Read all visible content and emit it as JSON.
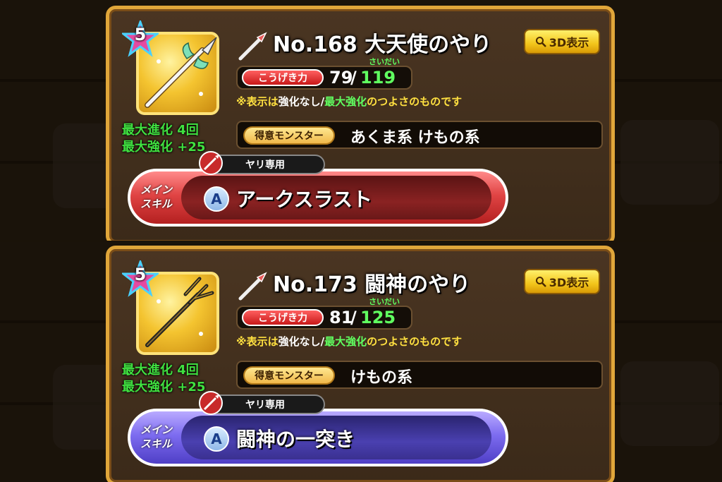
{
  "weapons": [
    {
      "rarity": "5",
      "number_name": "No.168  大天使のやり",
      "view3d_label": "3D表示",
      "attack_label": "こうげき力",
      "attack_current": "79",
      "attack_separator": "/",
      "attack_max": "119",
      "attack_furigana": "さいだい",
      "note_prefix": "※表示は",
      "note_plain": "強化なし/",
      "note_max": "最大強化",
      "note_suffix": "のつよさのものです",
      "max_evolution": "最大進化 4回",
      "max_enhance": "最大強化 +25",
      "monster_label": "得意モンスター",
      "monster_value": "あくま系 けもの系",
      "exclusive_label": "ヤリ専用",
      "main_skill_label_1": "メイン",
      "main_skill_label_2": "スキル",
      "skill_grade": "A",
      "skill_name": "アークスラスト",
      "skill_color": "#c82a2a"
    },
    {
      "rarity": "5",
      "number_name": "No.173  闘神のやり",
      "view3d_label": "3D表示",
      "attack_label": "こうげき力",
      "attack_current": "81",
      "attack_separator": "/",
      "attack_max": "125",
      "attack_furigana": "さいだい",
      "note_prefix": "※表示は",
      "note_plain": "強化なし/",
      "note_max": "最大強化",
      "note_suffix": "のつよさのものです",
      "max_evolution": "最大進化 4回",
      "max_enhance": "最大強化 +25",
      "monster_label": "得意モンスター",
      "monster_value": "けもの系",
      "exclusive_label": "ヤリ専用",
      "main_skill_label_1": "メイン",
      "main_skill_label_2": "スキル",
      "skill_grade": "A",
      "skill_name": "闘神の一突き",
      "skill_color": "#5a4ad8"
    }
  ],
  "colors": {
    "panel_border": "#e0a63a",
    "green_text": "#40e040",
    "yellow_text": "#ffe040"
  }
}
